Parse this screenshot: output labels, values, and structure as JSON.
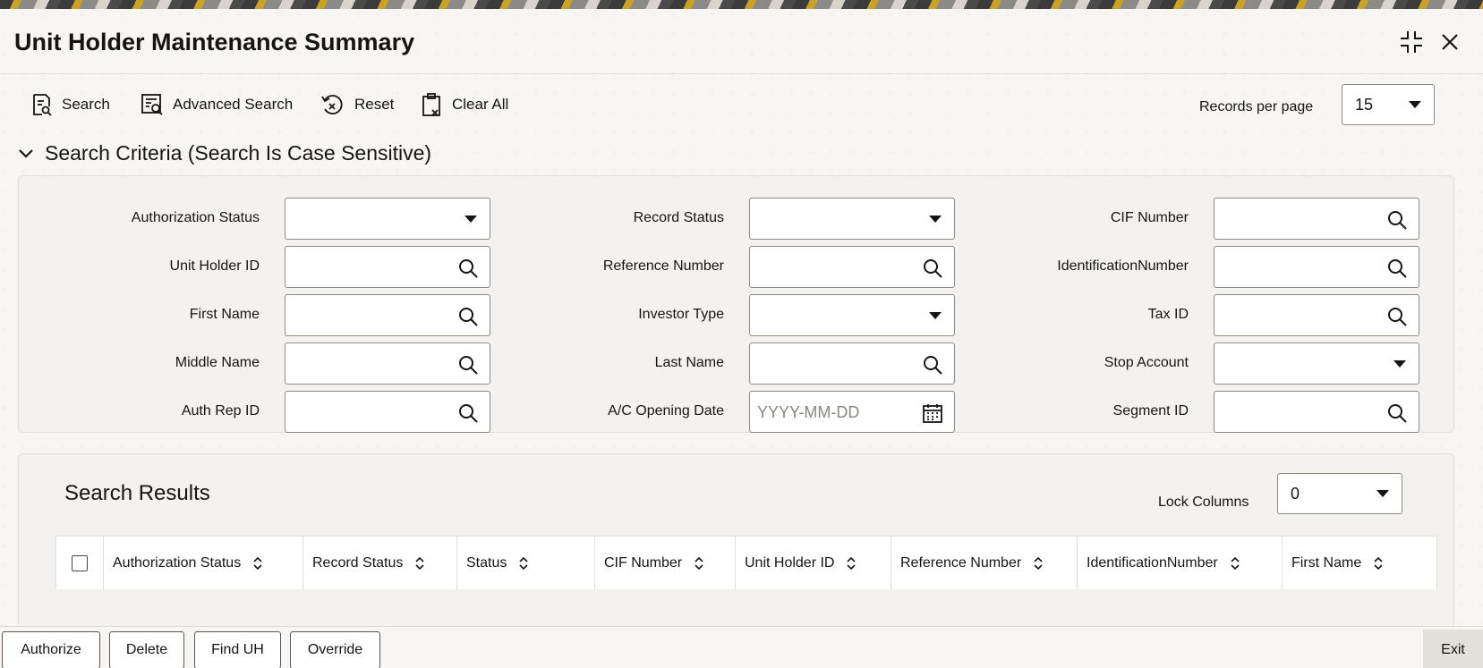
{
  "window": {
    "title": "Unit Holder Maintenance Summary"
  },
  "toolbar": {
    "search_label": "Search",
    "advanced_search_label": "Advanced Search",
    "reset_label": "Reset",
    "clear_all_label": "Clear All",
    "records_per_page_label": "Records per page",
    "records_per_page_value": "15"
  },
  "search_criteria": {
    "header": "Search Criteria (Search Is Case Sensitive)",
    "fields": {
      "authorization_status": {
        "label": "Authorization Status",
        "value": ""
      },
      "record_status": {
        "label": "Record Status",
        "value": ""
      },
      "cif_number": {
        "label": "CIF Number",
        "value": ""
      },
      "unit_holder_id": {
        "label": "Unit Holder ID",
        "value": ""
      },
      "reference_number": {
        "label": "Reference Number",
        "value": ""
      },
      "identification_number": {
        "label": "IdentificationNumber",
        "value": ""
      },
      "first_name": {
        "label": "First Name",
        "value": ""
      },
      "investor_type": {
        "label": "Investor Type",
        "value": ""
      },
      "tax_id": {
        "label": "Tax ID",
        "value": ""
      },
      "middle_name": {
        "label": "Middle Name",
        "value": ""
      },
      "last_name": {
        "label": "Last Name",
        "value": ""
      },
      "stop_account": {
        "label": "Stop Account",
        "value": ""
      },
      "auth_rep_id": {
        "label": "Auth Rep ID",
        "value": ""
      },
      "ac_opening_date": {
        "label": "A/C Opening Date",
        "value": "",
        "placeholder": "YYYY-MM-DD"
      },
      "segment_id": {
        "label": "Segment ID",
        "value": ""
      }
    }
  },
  "search_results": {
    "title": "Search Results",
    "lock_columns_label": "Lock Columns",
    "lock_columns_value": "0",
    "columns": [
      "Authorization Status",
      "Record Status",
      "Status",
      "CIF Number",
      "Unit Holder ID",
      "Reference Number",
      "IdentificationNumber",
      "First Name"
    ]
  },
  "footer": {
    "authorize_label": "Authorize",
    "delete_label": "Delete",
    "find_uh_label": "Find UH",
    "override_label": "Override",
    "exit_label": "Exit"
  }
}
